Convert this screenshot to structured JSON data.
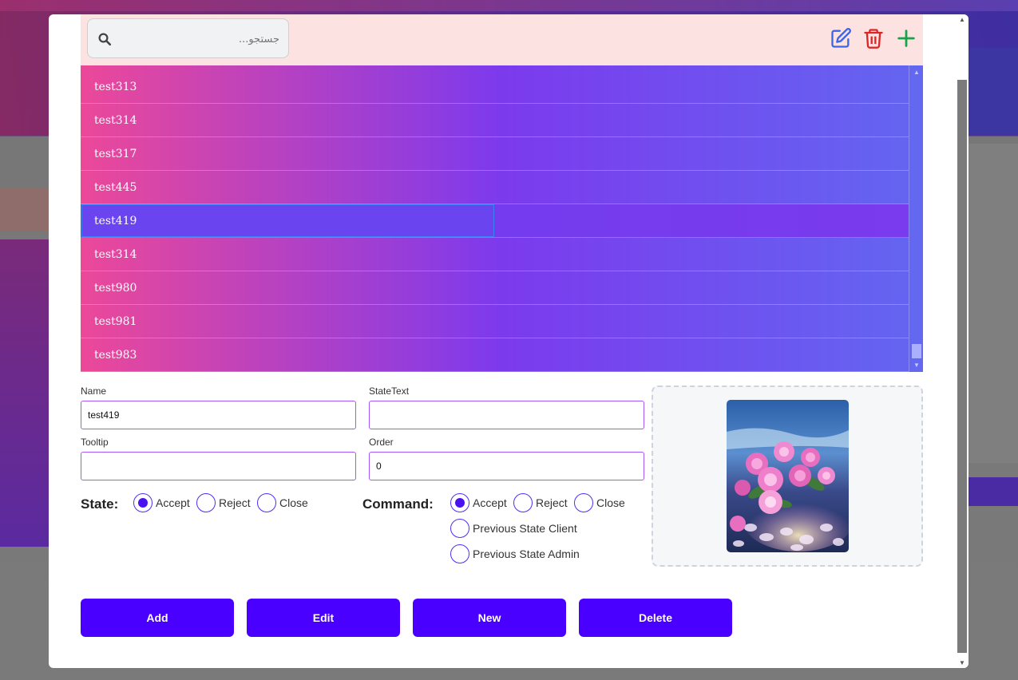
{
  "search": {
    "placeholder": "جستجو..."
  },
  "toolbar": {
    "edit_icon": "edit-icon",
    "delete_icon": "trash-icon",
    "add_icon": "plus-icon"
  },
  "list": {
    "items": [
      "test313",
      "test314",
      "test317",
      "test445",
      "test419",
      "test314",
      "test980",
      "test981",
      "test983"
    ],
    "selected_index": 4
  },
  "form": {
    "name_label": "Name",
    "name_value": "test419",
    "statetext_label": "StateText",
    "statetext_value": "",
    "tooltip_label": "Tooltip",
    "tooltip_value": "",
    "order_label": "Order",
    "order_value": "0"
  },
  "state": {
    "label": "State:",
    "options": [
      "Accept",
      "Reject",
      "Close"
    ],
    "selected": "Accept"
  },
  "command": {
    "label": "Command:",
    "options": [
      "Accept",
      "Reject",
      "Close",
      "Previous State Client",
      "Previous State Admin"
    ],
    "selected": "Accept"
  },
  "actions": {
    "add": "Add",
    "edit": "Edit",
    "new": "New",
    "delete": "Delete"
  },
  "colors": {
    "primary": "#4a00ff",
    "list_start": "#ec4899",
    "list_mid": "#7c3aed",
    "list_end": "#6366f1",
    "topbar": "#fde2e2",
    "field_border": "#a855f7"
  }
}
